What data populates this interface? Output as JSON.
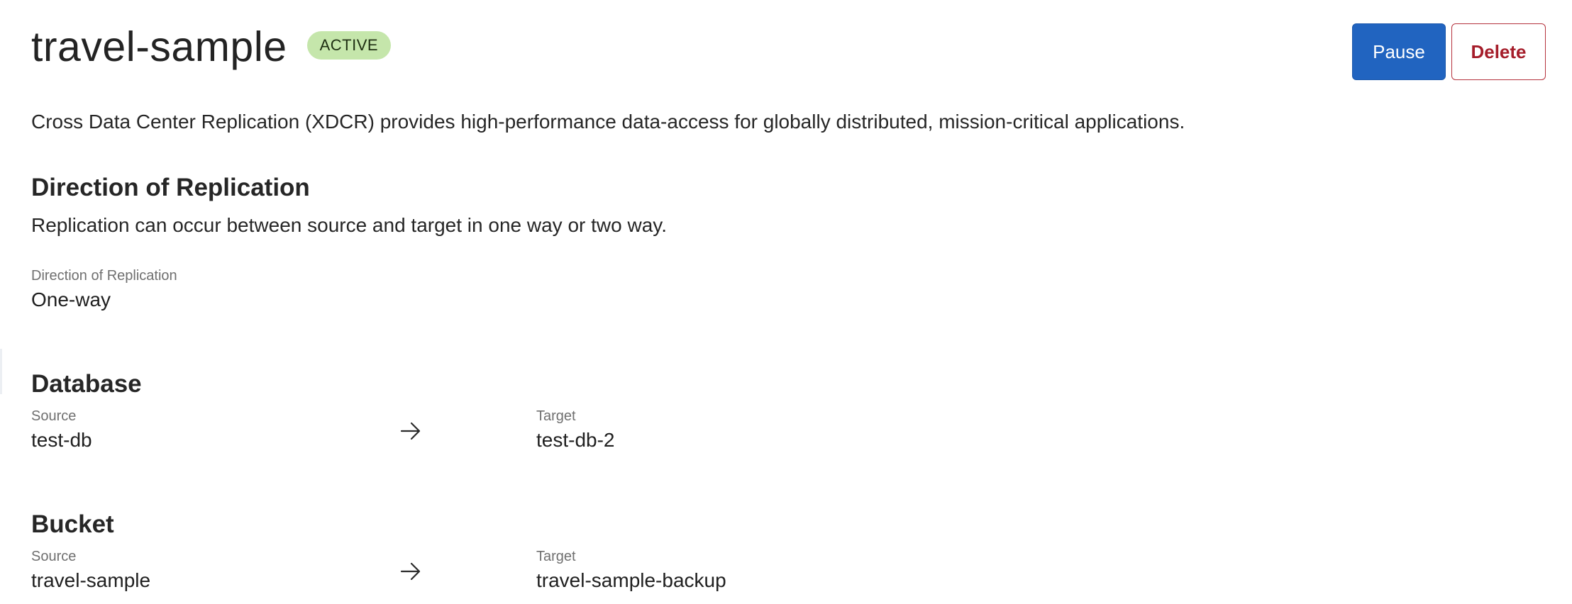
{
  "header": {
    "title": "travel-sample",
    "status": "ACTIVE",
    "pause_label": "Pause",
    "delete_label": "Delete"
  },
  "intro": "Cross Data Center Replication (XDCR) provides high-performance data-access for globally distributed, mission-critical applications.",
  "direction": {
    "title": "Direction of Replication",
    "description": "Replication can occur between source and target in one way or two way.",
    "field_label": "Direction of Replication",
    "field_value": "One-way"
  },
  "database": {
    "title": "Database",
    "source_label": "Source",
    "source_value": "test-db",
    "target_label": "Target",
    "target_value": "test-db-2",
    "arrow_icon": "arrow-right-icon"
  },
  "bucket": {
    "title": "Bucket",
    "source_label": "Source",
    "source_value": "travel-sample",
    "target_label": "Target",
    "target_value": "travel-sample-backup",
    "arrow_icon": "arrow-right-icon"
  },
  "colors": {
    "primary": "#2164c0",
    "danger": "#a51d2a",
    "badge_bg": "#c5e6ab"
  }
}
